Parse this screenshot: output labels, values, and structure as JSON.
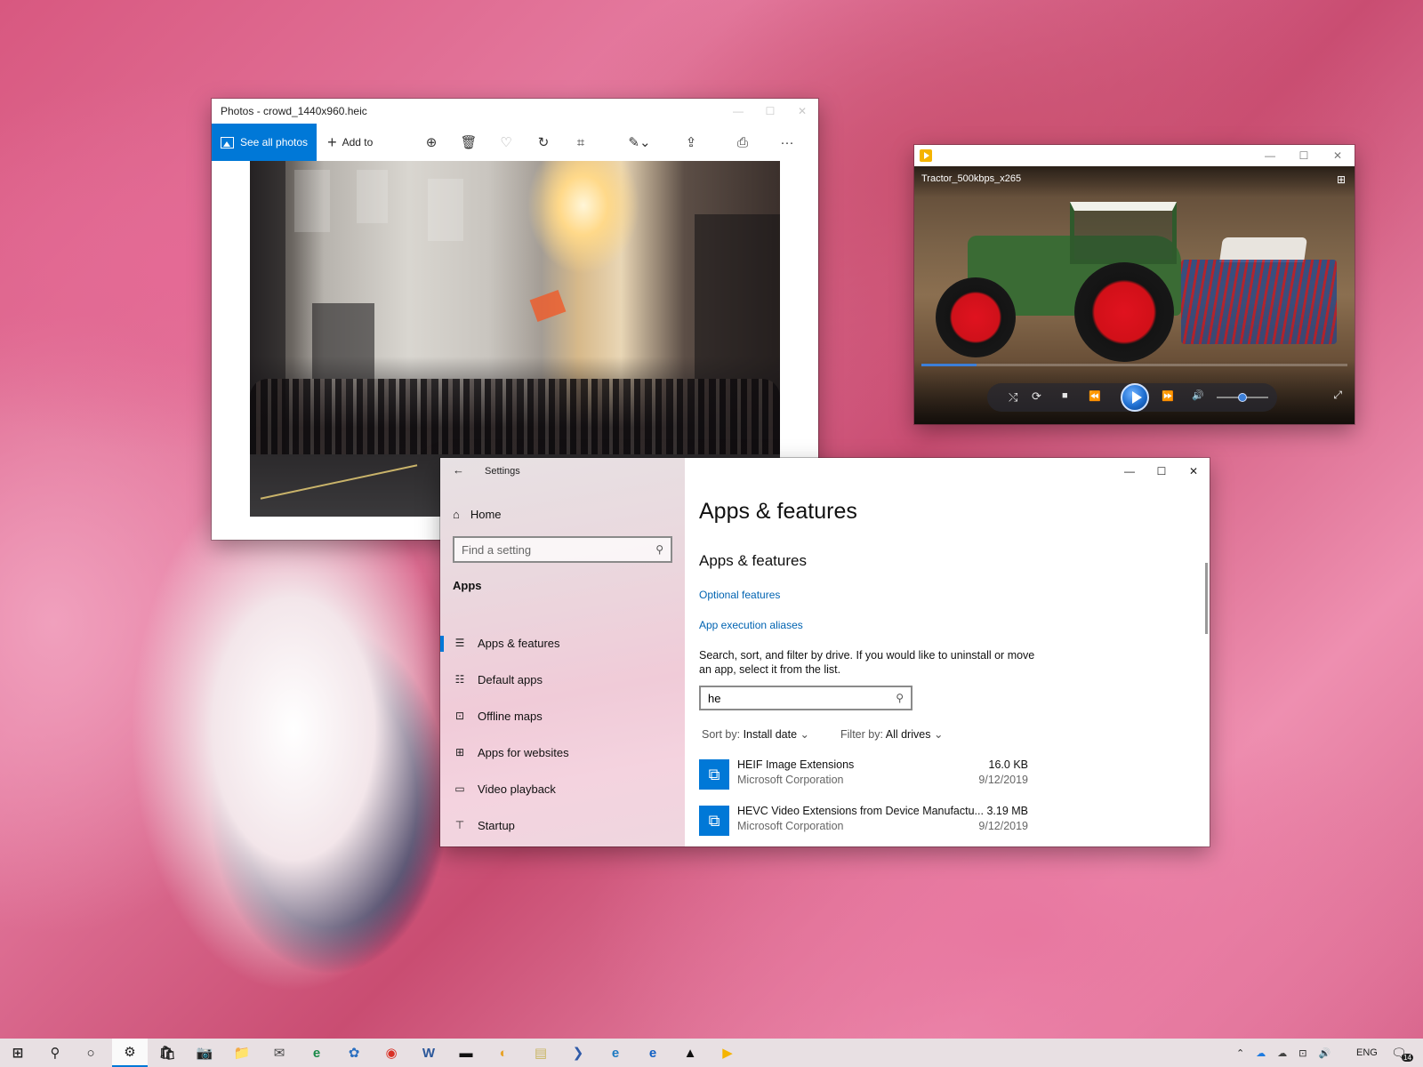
{
  "photos_window": {
    "title": "Photos - crowd_1440x960.heic",
    "see_all_label": "See all photos",
    "add_to_label": "Add to",
    "caption": {
      "minimize": "—",
      "maximize": "☐",
      "close": "✕"
    },
    "tools": {
      "zoom": "⊕",
      "delete": "🗑",
      "favorite": "♡",
      "rotate": "↻",
      "crop": "⌗",
      "edit": "✎⌄",
      "share": "⇪",
      "print": "⎙",
      "more": "···"
    }
  },
  "movies_window": {
    "video_title": "Tractor_500kbps_x265",
    "caption": {
      "minimize": "—",
      "maximize": "☐",
      "close": "✕"
    },
    "compact_icon": "⊞",
    "progress": 0.13,
    "volume": 0.5,
    "controls": {
      "shuffle": "⤭",
      "repeat": "⟳",
      "stop": "■",
      "rewind": "⏪",
      "forward": "⏩",
      "volume": "🔊",
      "fullscreen": "⤢"
    }
  },
  "settings_window": {
    "title": "Settings",
    "back_icon": "←",
    "home_label": "Home",
    "search_placeholder": "Find a setting",
    "category": "Apps",
    "nav_items": [
      {
        "label": "Apps & features",
        "icon": "☰"
      },
      {
        "label": "Default apps",
        "icon": "☷"
      },
      {
        "label": "Offline maps",
        "icon": "⊡"
      },
      {
        "label": "Apps for websites",
        "icon": "⊞"
      },
      {
        "label": "Video playback",
        "icon": "▭"
      },
      {
        "label": "Startup",
        "icon": "⊤"
      }
    ],
    "caption": {
      "minimize": "—",
      "maximize": "☐",
      "close": "✕"
    },
    "page_title": "Apps & features",
    "section_title": "Apps & features",
    "link_optional": "Optional features",
    "link_aliases": "App execution aliases",
    "description": "Search, sort, and filter by drive. If you would like to uninstall or move an app, select it from the list.",
    "search_value": "he",
    "sort_label": "Sort by:",
    "sort_value": "Install date",
    "filter_label": "Filter by:",
    "filter_value": "All drives",
    "apps": [
      {
        "name": "HEIF Image Extensions",
        "publisher": "Microsoft Corporation",
        "size": "16.0 KB",
        "date": "9/12/2019"
      },
      {
        "name": "HEVC Video Extensions from Device Manufactu...",
        "publisher": "Microsoft Corporation",
        "size": "3.19 MB",
        "date": "9/12/2019"
      }
    ]
  },
  "taskbar": {
    "language": "ENG",
    "notification_count": "14",
    "items": [
      {
        "name": "start",
        "icon": "⊞",
        "color": "#222222"
      },
      {
        "name": "search",
        "icon": "⚲",
        "color": "#222222"
      },
      {
        "name": "cortana",
        "icon": "○",
        "color": "#222222"
      },
      {
        "name": "settings",
        "icon": "⚙",
        "color": "#222222"
      },
      {
        "name": "store",
        "icon": "🛍",
        "color": "#222222"
      },
      {
        "name": "camera",
        "icon": "📷",
        "color": "#555555"
      },
      {
        "name": "file-explorer",
        "icon": "📁",
        "color": "#d9a400"
      },
      {
        "name": "mail",
        "icon": "✉",
        "color": "#444444"
      },
      {
        "name": "edge",
        "icon": "e",
        "color": "#1a8a48"
      },
      {
        "name": "app",
        "icon": "✿",
        "color": "#2a6fc1"
      },
      {
        "name": "chrome",
        "icon": "◉",
        "color": "#d93025"
      },
      {
        "name": "word",
        "icon": "W",
        "color": "#2b579a"
      },
      {
        "name": "terminal",
        "icon": "▬",
        "color": "#111111"
      },
      {
        "name": "paint",
        "icon": "◐",
        "color": "#e8a32a"
      },
      {
        "name": "notepad",
        "icon": "▤",
        "color": "#c8b560"
      },
      {
        "name": "powershell",
        "icon": "❯",
        "color": "#2f5aa8"
      },
      {
        "name": "edge-beta",
        "icon": "e",
        "color": "#1d7ac2"
      },
      {
        "name": "edge-legacy",
        "icon": "e",
        "color": "#1160c4"
      },
      {
        "name": "photos",
        "icon": "▲",
        "color": "#111111"
      },
      {
        "name": "movies",
        "icon": "▶",
        "color": "#f5b400"
      }
    ],
    "tray": {
      "chevron": "⌃",
      "onedrive": "☁",
      "onedrive2": "☁",
      "network": "⊡",
      "volume": "🔊",
      "action_center": "🗨"
    }
  }
}
